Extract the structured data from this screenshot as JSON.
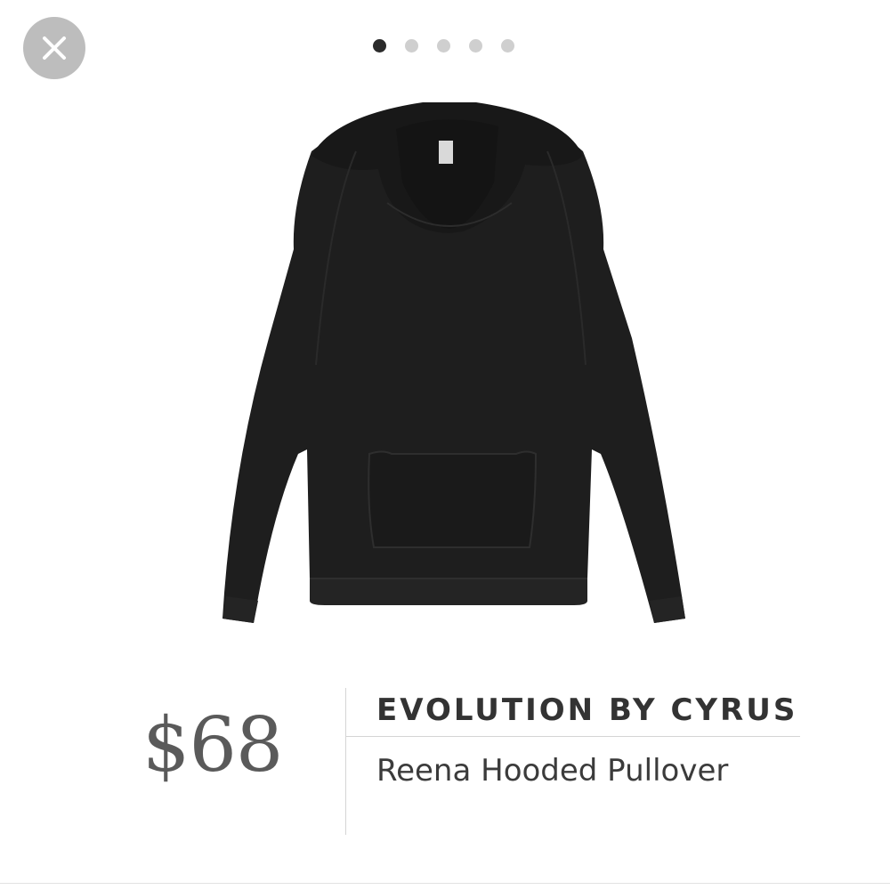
{
  "close_button": {
    "icon": "close-icon"
  },
  "carousel": {
    "total": 5,
    "active_index": 0
  },
  "product": {
    "image_icon": "hooded-pullover-image",
    "price": "$68",
    "brand": "EVOLUTION BY CYRUS",
    "name": "Reena Hooded Pullover"
  },
  "colors": {
    "garment": "#1e1e1e",
    "close_bg": "#bdbdbd",
    "dot_active": "#2b2b2b",
    "dot_inactive": "#cfcfcf"
  }
}
